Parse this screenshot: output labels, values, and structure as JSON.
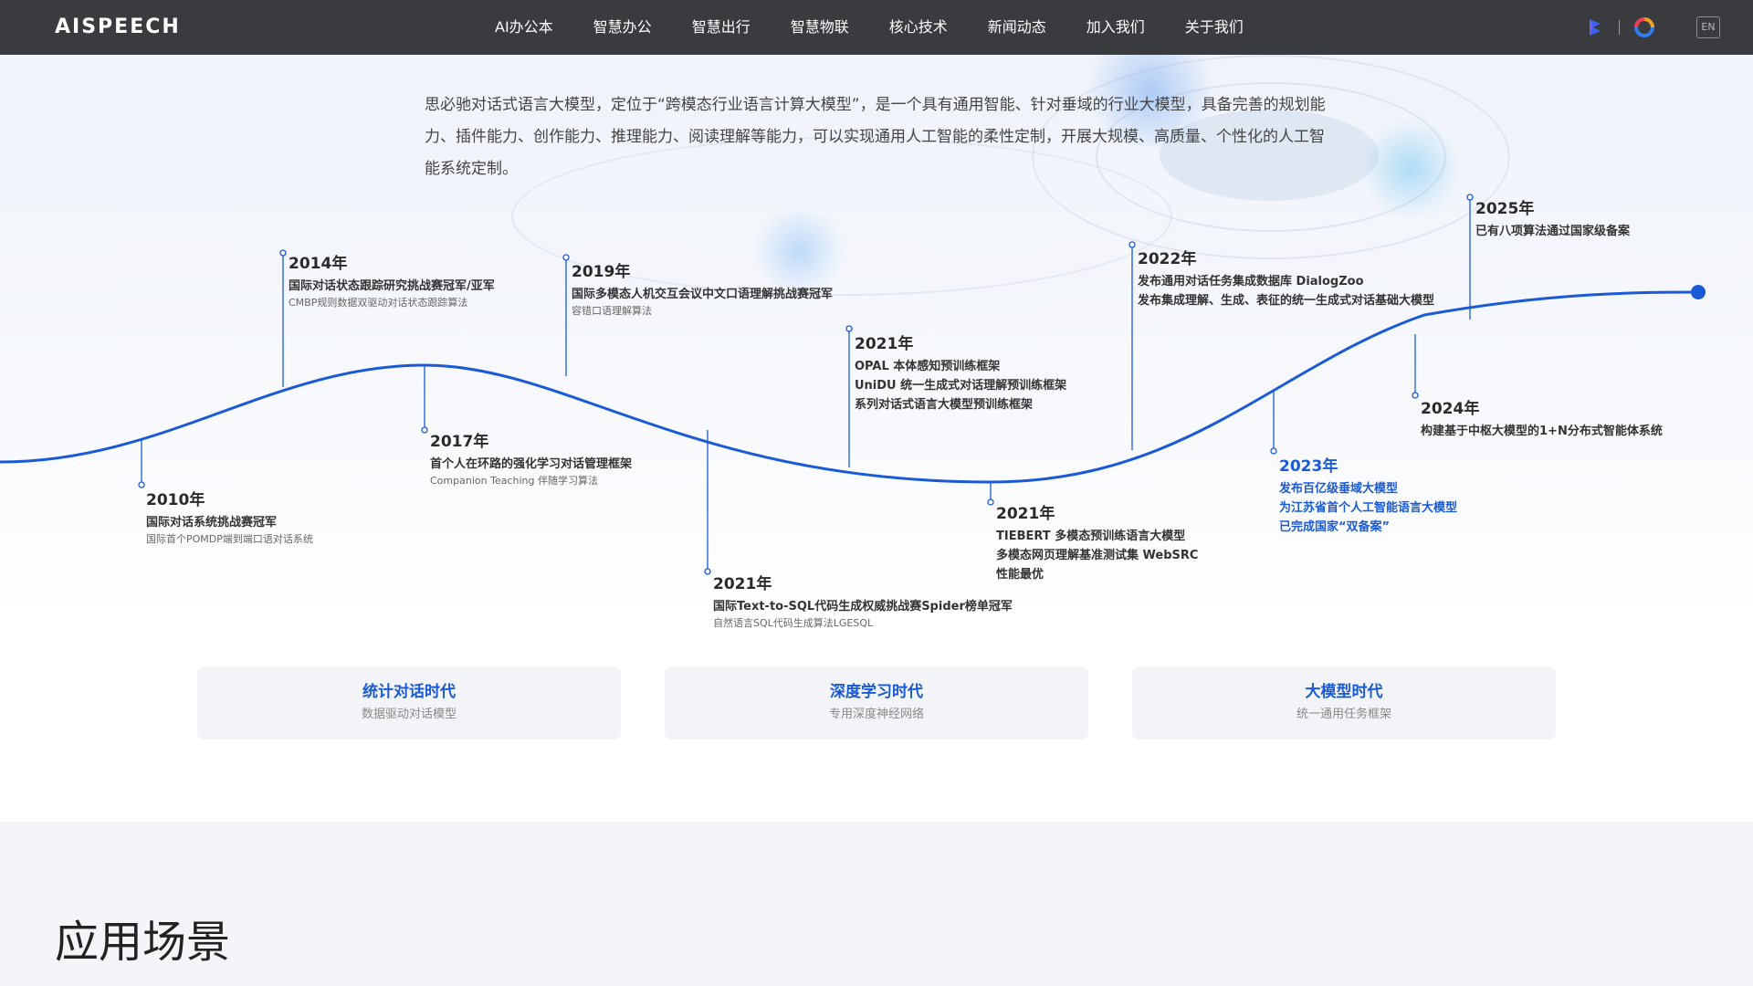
{
  "nav": {
    "logo": "AISPEECH",
    "items": [
      "AI办公本",
      "智慧办公",
      "智慧出行",
      "智慧物联",
      "核心技术",
      "新闻动态",
      "加入我们",
      "关于我们"
    ],
    "lang": "EN"
  },
  "intro": "思必驰对话式语言大模型，定位于“跨模态行业语言计算大模型”，是一个具有通用智能、针对垂域的行业大模型，具备完善的规划能力、插件能力、创作能力、推理能力、阅读理解等能力，可以实现通用人工智能的柔性定制，开展大规模、高质量、个性化的人工智能系统定制。",
  "timeline": [
    {
      "year": "2010年",
      "lines": [
        "国际对话系统挑战赛冠军"
      ],
      "sub": "国际首个POMDP端到端口语对话系统"
    },
    {
      "year": "2014年",
      "lines": [
        "国际对话状态跟踪研究挑战赛冠军/亚军"
      ],
      "sub": "CMBP规则数据双驱动对话状态跟踪算法"
    },
    {
      "year": "2017年",
      "lines": [
        "首个人在环路的强化学习对话管理框架"
      ],
      "sub": "Companion Teaching 伴随学习算法"
    },
    {
      "year": "2019年",
      "lines": [
        "国际多模态人机交互会议中文口语理解挑战赛冠军"
      ],
      "sub": "容错口语理解算法"
    },
    {
      "year": "2021年",
      "lines": [
        "国际Text-to-SQL代码生成权威挑战赛Spider榜单冠军"
      ],
      "sub": "自然语言SQL代码生成算法LGESQL"
    },
    {
      "year": "2021年",
      "lines": [
        "OPAL 本体感知预训练框架",
        "UniDU 统一生成式对话理解预训练框架",
        "系列对话式语言大模型预训练框架"
      ],
      "sub": ""
    },
    {
      "year": "2021年",
      "lines": [
        "TIEBERT 多模态预训练语言大模型",
        "多模态网页理解基准测试集 WebSRC",
        "性能最优"
      ],
      "sub": ""
    },
    {
      "year": "2022年",
      "lines": [
        "发布通用对话任务集成数据库 DialogZoo",
        "发布集成理解、生成、表征的统一生成式对话基础大模型"
      ],
      "sub": ""
    },
    {
      "year": "2023年",
      "lines": [
        "发布百亿级垂域大模型",
        "为江苏省首个人工智能语言大模型",
        "已完成国家“双备案”"
      ],
      "sub": "",
      "highlight": true
    },
    {
      "year": "2024年",
      "lines": [
        "构建基于中枢大模型的1+N分布式智能体系统"
      ],
      "sub": ""
    },
    {
      "year": "2025年",
      "lines": [
        "已有八项算法通过国家级备案"
      ],
      "sub": ""
    }
  ],
  "eras": [
    {
      "title": "统计对话时代",
      "sub": "数据驱动对话模型"
    },
    {
      "title": "深度学习时代",
      "sub": "专用深度神经网络"
    },
    {
      "title": "大模型时代",
      "sub": "统一通用任务框架"
    }
  ],
  "section": {
    "title": "应用场景"
  },
  "colors": {
    "accent": "#1a5ad6",
    "nav_bg": "#3a3b3f"
  }
}
